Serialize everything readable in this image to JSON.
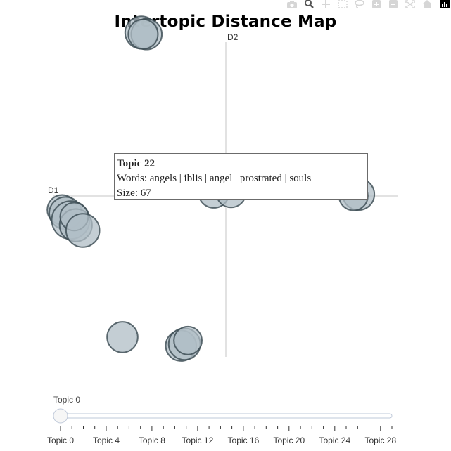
{
  "modebar": {
    "icons": [
      "camera-icon",
      "zoom-icon",
      "pan-icon",
      "box-select-icon",
      "lasso-icon",
      "zoom-in-icon",
      "zoom-out-icon",
      "autoscale-icon",
      "reset-icon",
      "plotly-logo-icon"
    ]
  },
  "chart_data": {
    "type": "scatter",
    "title": "Intertopic Distance Map",
    "xlabel": "D1",
    "ylabel": "D2",
    "xlim": [
      -1,
      1
    ],
    "ylim": [
      -1,
      1
    ],
    "grid": false,
    "points": [
      {
        "x": -0.49,
        "y": 0.95,
        "size": 0.7
      },
      {
        "x": -0.46,
        "y": 0.94,
        "size": 0.6
      },
      {
        "x": -0.48,
        "y": 0.94,
        "size": 0.55
      },
      {
        "x": -0.07,
        "y": 0.02,
        "size": 0.6
      },
      {
        "x": 0.03,
        "y": 0.02,
        "size": 0.55
      },
      {
        "x": 0.77,
        "y": 0.01,
        "size": 0.65
      },
      {
        "x": 0.74,
        "y": 0.0,
        "size": 0.5
      },
      {
        "x": -0.95,
        "y": -0.08,
        "size": 0.55
      },
      {
        "x": -0.93,
        "y": -0.1,
        "size": 0.7
      },
      {
        "x": -0.9,
        "y": -0.14,
        "size": 1.0
      },
      {
        "x": -0.87,
        "y": -0.17,
        "size": 0.7
      },
      {
        "x": -0.88,
        "y": -0.12,
        "size": 0.45
      },
      {
        "x": -0.83,
        "y": -0.2,
        "size": 0.75
      },
      {
        "x": -0.6,
        "y": -0.82,
        "size": 0.6
      },
      {
        "x": -0.26,
        "y": -0.87,
        "size": 0.6
      },
      {
        "x": -0.24,
        "y": -0.86,
        "size": 0.65
      },
      {
        "x": -0.22,
        "y": -0.84,
        "size": 0.45
      }
    ],
    "tooltip": {
      "title": "Topic 22",
      "words": "Words: angels | iblis | angel | prostrated | souls",
      "size": "Size: 67"
    },
    "slider": {
      "label": "Topic 0",
      "value": 0,
      "max": 29,
      "tick_labels": [
        "Topic 0",
        "Topic 4",
        "Topic 8",
        "Topic 12",
        "Topic 16",
        "Topic 20",
        "Topic 24",
        "Topic 28"
      ]
    },
    "colors": {
      "bubble_fill": "#b0bec5",
      "bubble_edge": "#37474f",
      "axis_line": "#d9d9d9",
      "slider_track": "#bec8d9"
    }
  }
}
